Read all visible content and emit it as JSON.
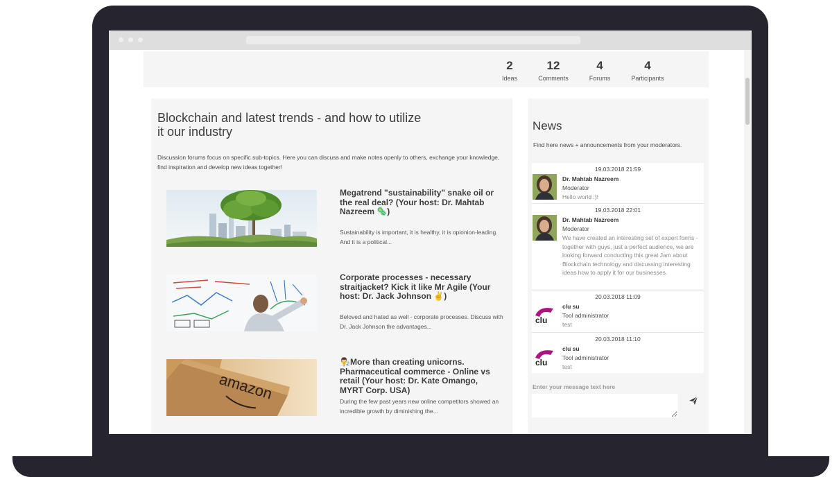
{
  "stats": [
    {
      "value": "2",
      "label": "Ideas"
    },
    {
      "value": "12",
      "label": "Comments"
    },
    {
      "value": "4",
      "label": "Forums"
    },
    {
      "value": "4",
      "label": "Participants"
    }
  ],
  "main": {
    "title": "Blockchain and latest trends - and how to utilize it our industry",
    "description": "Discussion forums focus on specific sub-topics. Here you can discuss and make notes openly to others, exchange your knowledge, find inspiration and develop new ideas together!",
    "topics": [
      {
        "title": "Megatrend \"sustainability\" snake oil or the real deal? (Your host: Dr. Mahtab Nazreem 🦠)",
        "excerpt": "Sustainability is important, it is healthy, it is opionion-leading. And it is a political...",
        "image": "tree-city-image"
      },
      {
        "title": "Corporate processes - necessary straitjacket? Kick it like Mr Agile (Your host: Dr. Jack Johnson ✌️)",
        "excerpt": "Beloved and hated as well - corporate processes. Discuss with Dr. Jack Johnson the advantages...",
        "image": "whiteboard-image"
      },
      {
        "title": "👨‍🔬More than creating unicorns. Pharmaceutical commerce - Online vs retail (Your host: Dr. Kate Omango, MYRT Corp. USA)",
        "excerpt": "During the few past years new online competitors showed an incredible growth by diminishing the...",
        "image": "amazon-box-image",
        "box_text": "amazon"
      }
    ]
  },
  "news": {
    "title": "News",
    "subtitle": "Find here news + announcements from your moderators.",
    "messages": [
      {
        "date": "19.03.2018 21:59",
        "author": "Dr. Mahtab Nazreem",
        "role": "Moderator",
        "text": "Hello world :)!",
        "avatar": "person-avatar"
      },
      {
        "date": "19.03.2018 22:01",
        "author": "Dr. Mahtab Nazreem",
        "role": "Moderator",
        "text": "We have created an interesting set of expert forms - together with guys, just a perfect audience, we are looking forward conducting this great Jam about Blockchain technology and discussing interesting ideas how to apply it for our businesses.",
        "avatar": "person-avatar"
      },
      {
        "date": "20.03.2018 11:09",
        "author": "clu su",
        "role": "Tool administrator",
        "text": "test",
        "avatar": "clu-logo"
      },
      {
        "date": "20.03.2018 11:10",
        "author": "clu su",
        "role": "Tool administrator",
        "text": "test",
        "avatar": "clu-logo"
      }
    ],
    "logo_text": "clu",
    "compose_label": "Enter your message text here",
    "send_icon": "paper-plane-icon"
  }
}
